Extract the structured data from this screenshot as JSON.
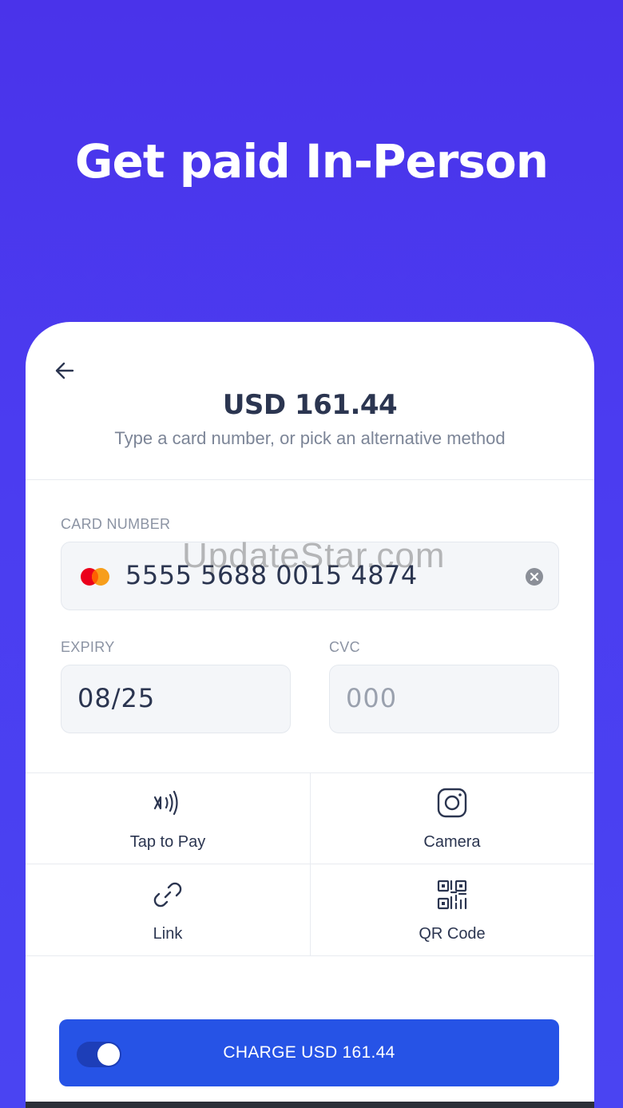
{
  "hero": {
    "title": "Get paid In-Person"
  },
  "payment": {
    "amount": "USD 161.44",
    "subtitle": "Type a card number, or pick an alternative method"
  },
  "card_number": {
    "label": "CARD NUMBER",
    "value": "5555 5688 0015 4874",
    "brand_icon": "mastercard-icon"
  },
  "expiry": {
    "label": "EXPIRY",
    "value": "08/25"
  },
  "cvc": {
    "label": "CVC",
    "placeholder": "000"
  },
  "methods": [
    {
      "label": "Tap to Pay",
      "icon": "nfc-icon"
    },
    {
      "label": "Camera",
      "icon": "camera-icon"
    },
    {
      "label": "Link",
      "icon": "link-icon"
    },
    {
      "label": "QR Code",
      "icon": "qr-code-icon"
    }
  ],
  "charge": {
    "label": "CHARGE USD 161.44",
    "toggle_on": true
  },
  "watermark": "UpdateStar.com",
  "colors": {
    "background": "#4a3cf0",
    "button": "#2653e6",
    "text": "#2b3550"
  }
}
